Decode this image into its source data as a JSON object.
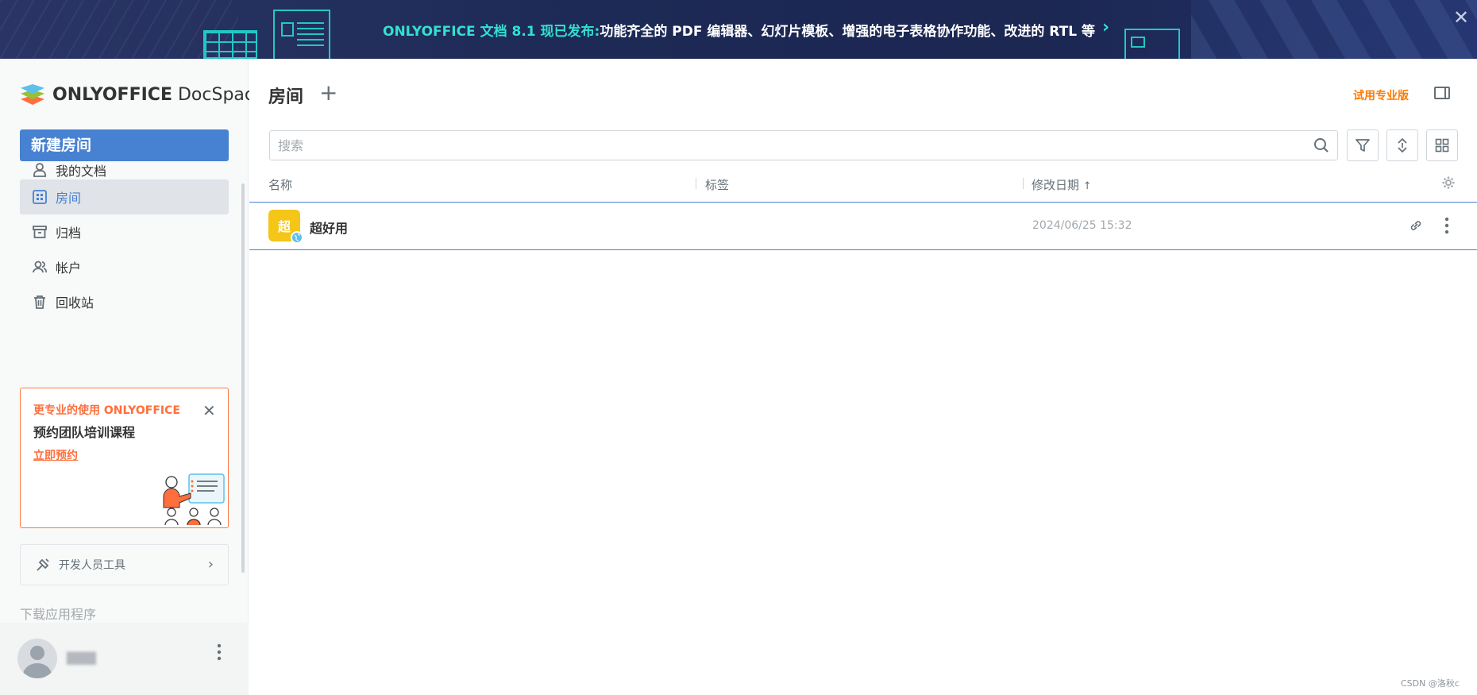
{
  "banner": {
    "highlight": "ONLYOFFICE 文档 8.1 现已发布:",
    "text": "功能齐全的 PDF 编辑器、幻灯片模板、增强的电子表格协作功能、改进的 RTL 等",
    "chevron": "›",
    "close": "✕"
  },
  "sidebar": {
    "logo_bold": "ONLYOFFICE",
    "logo_light": " DocSpace",
    "new_room_label": "新建房间",
    "items": [
      {
        "label": "我的文档",
        "icon": "person-icon"
      },
      {
        "label": "房间",
        "icon": "rooms-grid-icon",
        "active": true
      },
      {
        "label": "归档",
        "icon": "archive-icon"
      },
      {
        "label": "帐户",
        "icon": "accounts-icon"
      },
      {
        "label": "回收站",
        "icon": "trash-icon"
      }
    ],
    "promo": {
      "title": "更专业的使用 ONLYOFFICE",
      "subtitle": "预约团队培训课程",
      "link": "立即预约",
      "close": "✕"
    },
    "dev_tools_label": "开发人员工具",
    "download_apps": "下载应用程序",
    "profile_name": "▇▇▇",
    "profile_menu": "⋮"
  },
  "main": {
    "title": "房间",
    "add_symbol": "+",
    "trial_label": "试用专业版",
    "search_placeholder": "搜索",
    "columns": {
      "name": "名称",
      "tags": "标签",
      "modified": "修改日期",
      "sort_arrow": "↑"
    },
    "rooms": [
      {
        "icon_char": "超",
        "name": "超好用",
        "date": "2024/06/25 15:32",
        "icon_color": "#f5c518"
      }
    ]
  },
  "watermark": "CSDN @洛秋c",
  "colors": {
    "accent": "#4781d1",
    "orange": "#ff7a00",
    "banner_highlight": "#33e0d0"
  }
}
